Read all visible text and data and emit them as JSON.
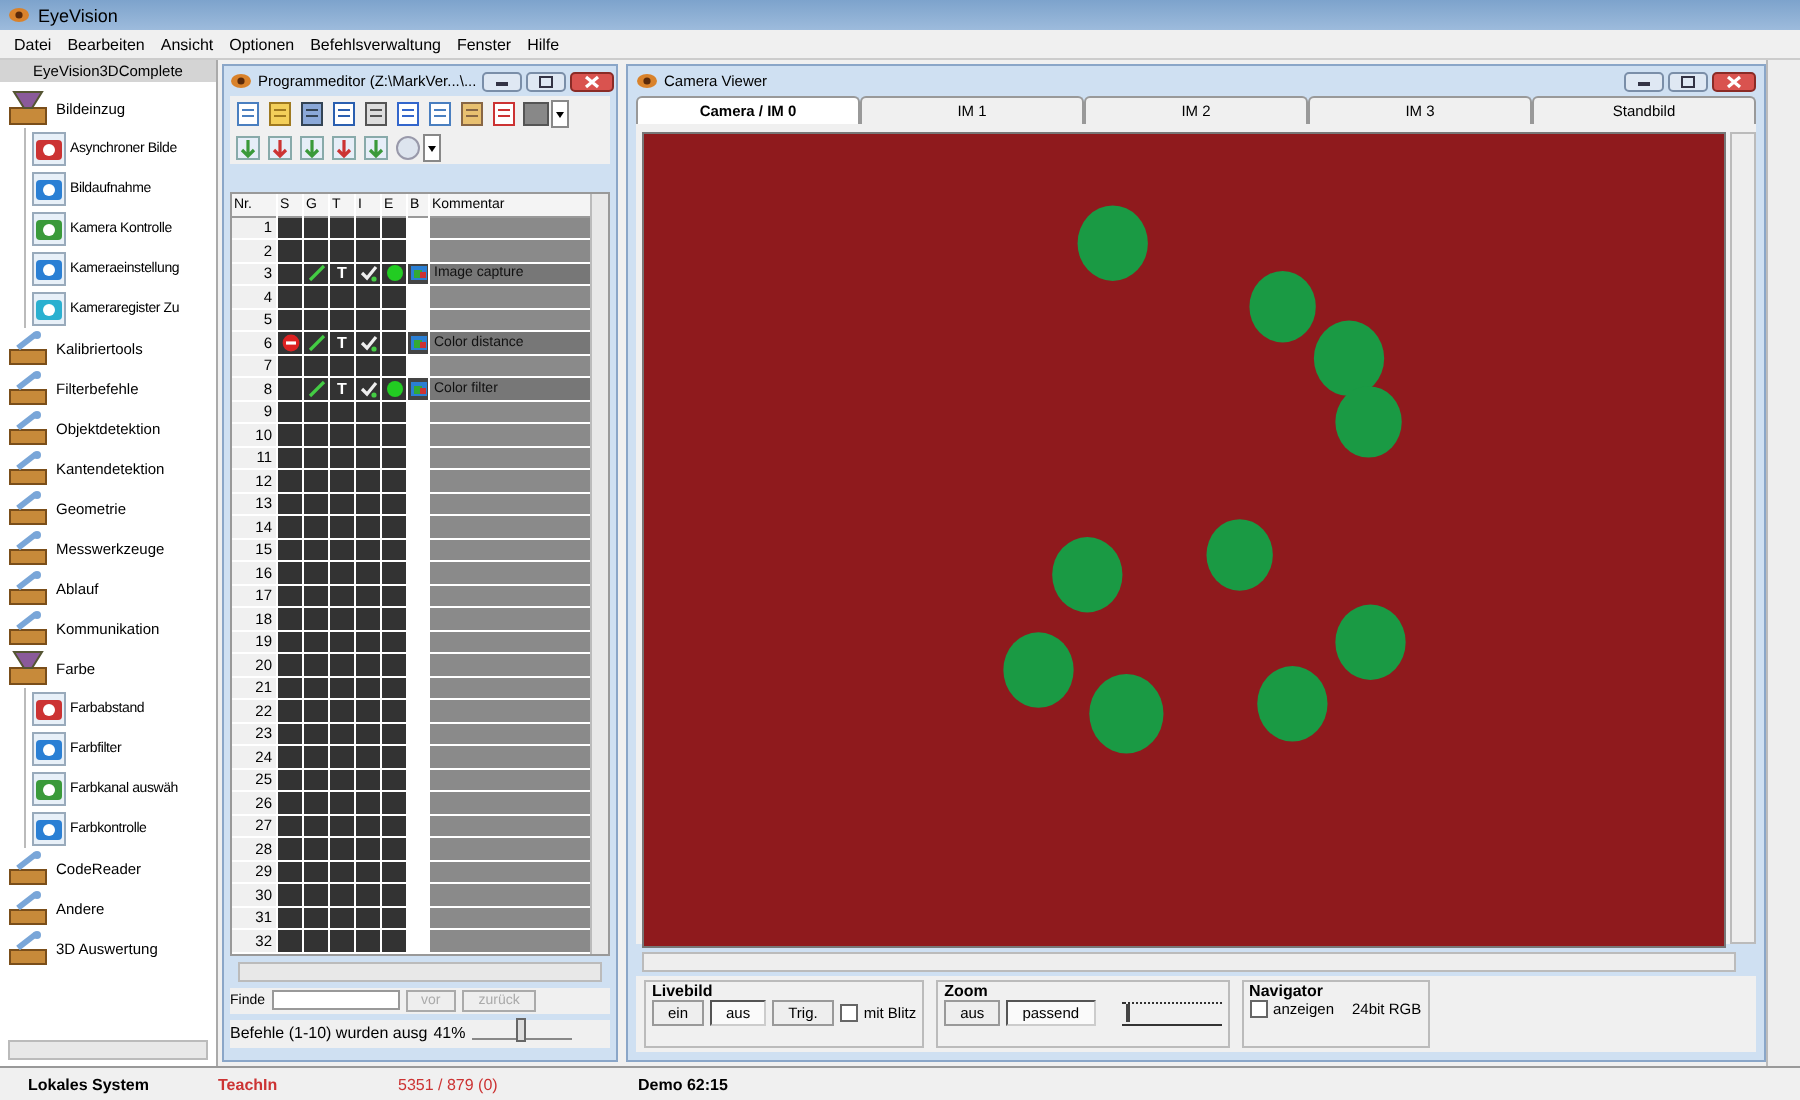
{
  "window": {
    "title": "EyeVision"
  },
  "menu": [
    "Datei",
    "Bearbeiten",
    "Ansicht",
    "Optionen",
    "Befehlsverwaltung",
    "Fenster",
    "Hilfe"
  ],
  "sidebar": {
    "title": "EyeVision3DComplete",
    "items": [
      {
        "label": "Bildeinzug",
        "expanded": true,
        "children": [
          {
            "label": "Asynchroner Bilde"
          },
          {
            "label": "Bildaufnahme"
          },
          {
            "label": "Kamera Kontrolle"
          },
          {
            "label": "Kameraeinstellung"
          },
          {
            "label": "Kameraregister Zu"
          }
        ]
      },
      {
        "label": "Kalibriertools",
        "expanded": false
      },
      {
        "label": "Filterbefehle",
        "expanded": false
      },
      {
        "label": "Objektdetektion",
        "expanded": false
      },
      {
        "label": "Kantendetektion",
        "expanded": false
      },
      {
        "label": "Geometrie",
        "expanded": false
      },
      {
        "label": "Messwerkzeuge",
        "expanded": false
      },
      {
        "label": "Ablauf",
        "expanded": false
      },
      {
        "label": "Kommunikation",
        "expanded": false
      },
      {
        "label": "Farbe",
        "expanded": true,
        "children": [
          {
            "label": "Farbabstand"
          },
          {
            "label": "Farbfilter"
          },
          {
            "label": "Farbkanal auswäh"
          },
          {
            "label": "Farbkontrolle"
          }
        ]
      },
      {
        "label": "CodeReader",
        "expanded": false
      },
      {
        "label": "Andere",
        "expanded": false
      },
      {
        "label": "3D Auswertung",
        "expanded": false
      }
    ]
  },
  "program_editor": {
    "title": "Programmeditor (Z:\\MarkVer...\\...",
    "columns": [
      "Nr.",
      "S",
      "G",
      "T",
      "I",
      "E",
      "B",
      "Kommentar"
    ],
    "rows": [
      {
        "nr": "1",
        "kind": "empty"
      },
      {
        "nr": "2",
        "kind": "empty"
      },
      {
        "nr": "3",
        "kind": "command",
        "stopped": false,
        "editable": true,
        "type": "T",
        "checked": true,
        "active": true,
        "comment": "Image capture"
      },
      {
        "nr": "4",
        "kind": "empty"
      },
      {
        "nr": "5",
        "kind": "empty"
      },
      {
        "nr": "6",
        "kind": "command",
        "stopped": true,
        "editable": true,
        "type": "T",
        "checked": true,
        "active": false,
        "comment": "Color distance"
      },
      {
        "nr": "7",
        "kind": "empty"
      },
      {
        "nr": "8",
        "kind": "command",
        "stopped": false,
        "editable": true,
        "type": "T",
        "checked": true,
        "active": true,
        "comment": "Color filter"
      },
      {
        "nr": "9",
        "kind": "empty"
      },
      {
        "nr": "10",
        "kind": "empty"
      },
      {
        "nr": "11",
        "kind": "empty"
      },
      {
        "nr": "12",
        "kind": "empty"
      },
      {
        "nr": "13",
        "kind": "empty"
      },
      {
        "nr": "14",
        "kind": "empty"
      },
      {
        "nr": "15",
        "kind": "empty"
      },
      {
        "nr": "16",
        "kind": "empty"
      },
      {
        "nr": "17",
        "kind": "empty"
      },
      {
        "nr": "18",
        "kind": "empty"
      },
      {
        "nr": "19",
        "kind": "empty"
      },
      {
        "nr": "20",
        "kind": "empty"
      },
      {
        "nr": "21",
        "kind": "empty"
      },
      {
        "nr": "22",
        "kind": "empty"
      },
      {
        "nr": "23",
        "kind": "empty"
      },
      {
        "nr": "24",
        "kind": "empty"
      },
      {
        "nr": "25",
        "kind": "empty"
      },
      {
        "nr": "26",
        "kind": "empty"
      },
      {
        "nr": "27",
        "kind": "empty"
      },
      {
        "nr": "28",
        "kind": "empty"
      },
      {
        "nr": "29",
        "kind": "empty"
      },
      {
        "nr": "30",
        "kind": "empty"
      },
      {
        "nr": "31",
        "kind": "empty"
      },
      {
        "nr": "32",
        "kind": "empty"
      }
    ],
    "find_label": "Finde",
    "find_buttons": [
      {
        "label": "vor",
        "disabled": true
      },
      {
        "label": "zurück",
        "disabled": true
      }
    ],
    "message": "Befehle (1-10) wurden ausg",
    "zoom": "41%",
    "zoom_slider": {
      "level": 0.45
    }
  },
  "camera_viewer": {
    "title": "Camera Viewer",
    "tabs": [
      {
        "label": "Camera / IM 0",
        "selected": true
      },
      {
        "label": "IM 1",
        "selected": false
      },
      {
        "label": "IM 2",
        "selected": false
      },
      {
        "label": "IM 3",
        "selected": false
      },
      {
        "label": "Standbild",
        "selected": false
      }
    ],
    "livebild": {
      "title": "Livebild",
      "buttons": [
        {
          "label": "ein",
          "pressed": false
        },
        {
          "label": "aus",
          "pressed": true
        },
        {
          "label": "Trig.",
          "pressed": false
        }
      ],
      "flash": {
        "label": "mit Blitz",
        "checked": false
      }
    },
    "zoom": {
      "title": "Zoom",
      "buttons": [
        {
          "label": "aus",
          "pressed": false
        },
        {
          "label": "passend",
          "pressed": true
        }
      ],
      "slider": {
        "level": 0.05
      }
    },
    "navigator": {
      "title": "Navigator",
      "show": {
        "label": "anzeigen",
        "checked": false
      },
      "format": "24bit RGB"
    }
  },
  "status_bar": {
    "system": "Lokales System",
    "mode": "TeachIn",
    "counts": "5351 / 879 (0)",
    "demo": "Demo 62:15"
  }
}
